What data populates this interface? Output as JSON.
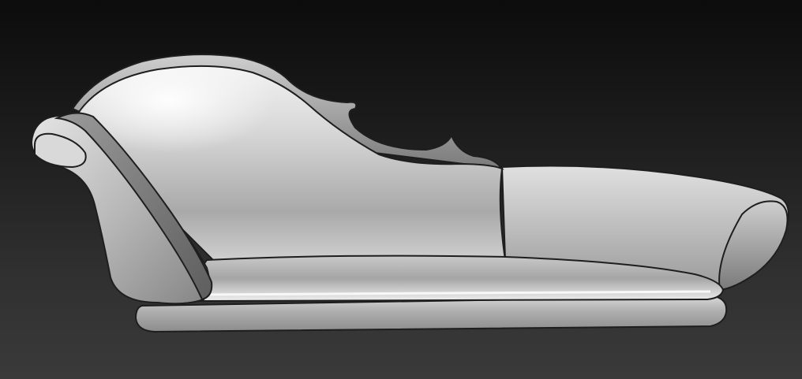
{
  "scene": {
    "subject": "chaise-longue-sculpt",
    "material": "matcap-grey-clay",
    "background": {
      "top_color": "#0c0c0c",
      "bottom_color": "#3a3a3a"
    },
    "colors": {
      "clay_light": "#e6e6e6",
      "clay_mid": "#b4b4b4",
      "clay_dark": "#6e6e6e",
      "outline": "#1e1e1e"
    }
  }
}
